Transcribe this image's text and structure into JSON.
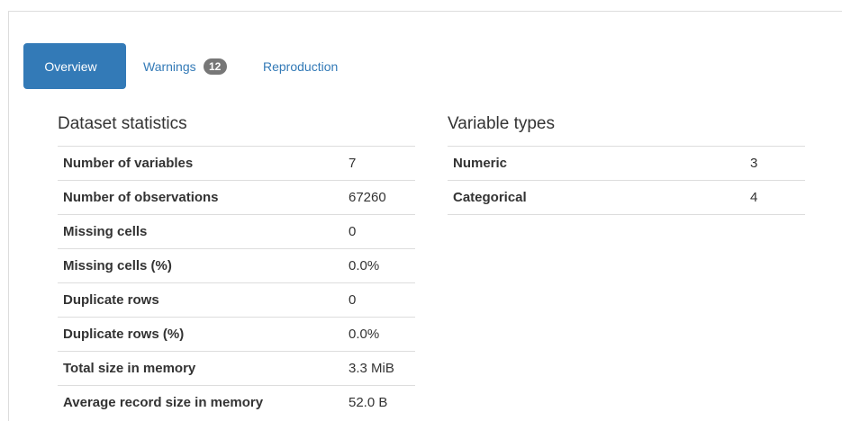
{
  "tabs": {
    "overview": "Overview",
    "warnings": "Warnings",
    "warnings_count": "12",
    "reproduction": "Reproduction"
  },
  "dataset_statistics": {
    "title": "Dataset statistics",
    "rows": [
      {
        "label": "Number of variables",
        "value": "7"
      },
      {
        "label": "Number of observations",
        "value": "67260"
      },
      {
        "label": "Missing cells",
        "value": "0"
      },
      {
        "label": "Missing cells (%)",
        "value": "0.0%"
      },
      {
        "label": "Duplicate rows",
        "value": "0"
      },
      {
        "label": "Duplicate rows (%)",
        "value": "0.0%"
      },
      {
        "label": "Total size in memory",
        "value": "3.3 MiB"
      },
      {
        "label": "Average record size in memory",
        "value": "52.0 B"
      }
    ]
  },
  "variable_types": {
    "title": "Variable types",
    "rows": [
      {
        "label": "Numeric",
        "value": "3"
      },
      {
        "label": "Categorical",
        "value": "4"
      }
    ]
  },
  "colors": {
    "accent": "#337ab7",
    "badge": "#777777",
    "border": "#dddddd",
    "text": "#333333"
  }
}
